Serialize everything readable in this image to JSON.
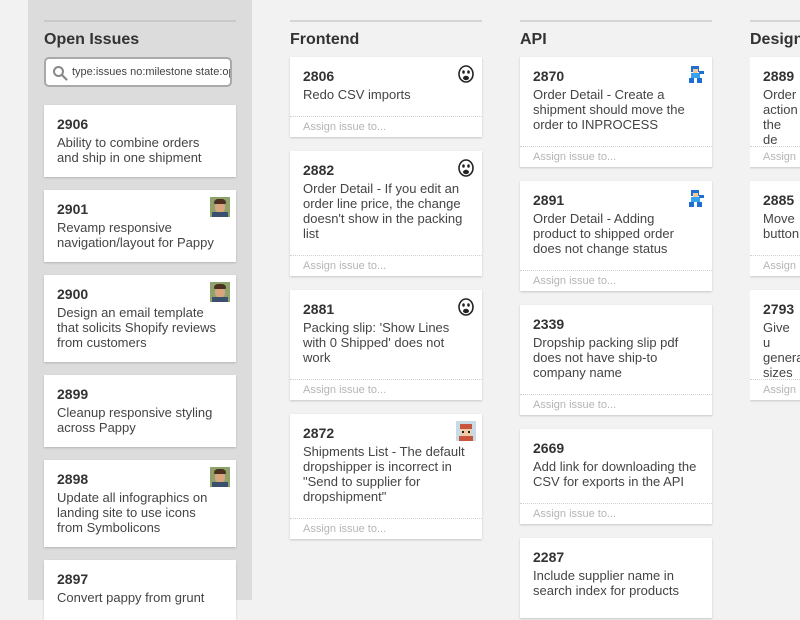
{
  "backlog": {
    "title": "Open Issues",
    "search": {
      "value": "type:issues no:milestone state:open"
    },
    "cards": [
      {
        "number": "2906",
        "title": "Ability to combine orders and ship in one shipment",
        "avatar": ""
      },
      {
        "number": "2901",
        "title": "Revamp responsive navigation/layout for Pappy",
        "avatar": "photo-avatar"
      },
      {
        "number": "2900",
        "title": "Design an email template that solicits Shopify reviews from customers",
        "avatar": "photo-avatar"
      },
      {
        "number": "2899",
        "title": "Cleanup responsive styling across Pappy",
        "avatar": ""
      },
      {
        "number": "2898",
        "title": "Update all infographics on landing site to use icons from Symbolicons",
        "avatar": "photo-avatar"
      },
      {
        "number": "2897",
        "title": "Convert pappy from grunt",
        "avatar": ""
      }
    ]
  },
  "columns": [
    {
      "title": "Frontend",
      "cards": [
        {
          "number": "2806",
          "title": "Redo CSV imports",
          "assign": "Assign issue to...",
          "avatar": "monkey-avatar"
        },
        {
          "number": "2882",
          "title": "Order Detail - If you edit an order line price, the change doesn't show in the packing list",
          "assign": "Assign issue to...",
          "avatar": "monkey-avatar"
        },
        {
          "number": "2881",
          "title": "Packing slip: 'Show Lines with 0 Shipped' does not work",
          "assign": "Assign issue to...",
          "avatar": "monkey-avatar"
        },
        {
          "number": "2872",
          "title": "Shipments List - The default dropshipper is incorrect in \"Send to supplier for dropshipment\"",
          "assign": "Assign issue to...",
          "avatar": "pixel-avatar"
        }
      ]
    },
    {
      "title": "API",
      "cards": [
        {
          "number": "2870",
          "title": "Order Detail - Create a shipment should move the order to INPROCESS",
          "assign": "Assign issue to...",
          "avatar": "megaman-avatar"
        },
        {
          "number": "2891",
          "title": "Order Detail - Adding product to shipped order does not change status",
          "assign": "Assign issue to...",
          "avatar": "megaman-avatar"
        },
        {
          "number": "2339",
          "title": "Dropship packing slip pdf does not have ship-to company name",
          "assign": "Assign issue to...",
          "avatar": ""
        },
        {
          "number": "2669",
          "title": "Add link for downloading the CSV for exports in the API",
          "assign": "Assign issue to...",
          "avatar": ""
        },
        {
          "number": "2287",
          "title": "Include supplier name in search index for products",
          "assign": "",
          "avatar": ""
        }
      ]
    },
    {
      "title": "Design",
      "cards": [
        {
          "number": "2889",
          "title": "Order action the de",
          "assign": "Assign",
          "avatar": ""
        },
        {
          "number": "2885",
          "title": "Move button",
          "assign": "Assign",
          "avatar": ""
        },
        {
          "number": "2793",
          "title": "Give u genera sizes",
          "assign": "Assign",
          "avatar": ""
        }
      ]
    }
  ]
}
